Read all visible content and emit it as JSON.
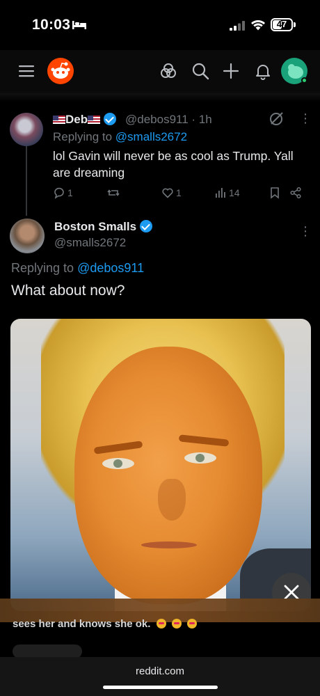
{
  "status_bar": {
    "time": "10:03",
    "battery": "47",
    "battery_level": 0.47
  },
  "header": {
    "icons": [
      "menu-icon",
      "reddit-logo",
      "hub-icon",
      "search-icon",
      "plus-icon",
      "bell-icon",
      "avatar"
    ]
  },
  "tweet1": {
    "name": "Deb",
    "handle": "@debos911 · 1h",
    "replying_prefix": "Replying to",
    "replying_to": "@smalls2672",
    "text": "lol Gavin will never be as cool as Trump. Yall are dreaming",
    "counts": {
      "replies": "1",
      "retweets": "",
      "likes": "1",
      "views": "14"
    }
  },
  "tweet2": {
    "name": "Boston Smalls",
    "handle": "@smalls2672",
    "replying_prefix": "Replying to",
    "replying_to": "@debos911",
    "text": "What about now?"
  },
  "comment_snippet": "sees her and knows she ok.",
  "browser": {
    "url": "reddit.com"
  },
  "colors": {
    "accent": "#1d9bf0",
    "reddit": "#ff4500",
    "muted": "#71767b"
  }
}
